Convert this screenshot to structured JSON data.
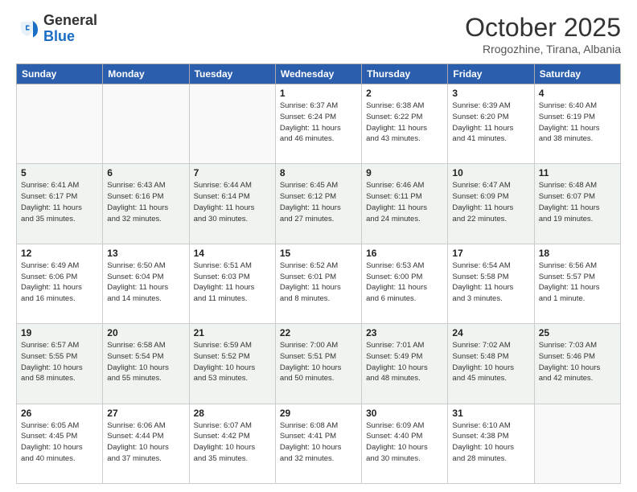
{
  "header": {
    "logo_general": "General",
    "logo_blue": "Blue",
    "month_title": "October 2025",
    "location": "Rrogozhine, Tirana, Albania"
  },
  "columns": [
    "Sunday",
    "Monday",
    "Tuesday",
    "Wednesday",
    "Thursday",
    "Friday",
    "Saturday"
  ],
  "weeks": [
    {
      "shaded": false,
      "days": [
        {
          "num": "",
          "info": ""
        },
        {
          "num": "",
          "info": ""
        },
        {
          "num": "",
          "info": ""
        },
        {
          "num": "1",
          "info": "Sunrise: 6:37 AM\nSunset: 6:24 PM\nDaylight: 11 hours\nand 46 minutes."
        },
        {
          "num": "2",
          "info": "Sunrise: 6:38 AM\nSunset: 6:22 PM\nDaylight: 11 hours\nand 43 minutes."
        },
        {
          "num": "3",
          "info": "Sunrise: 6:39 AM\nSunset: 6:20 PM\nDaylight: 11 hours\nand 41 minutes."
        },
        {
          "num": "4",
          "info": "Sunrise: 6:40 AM\nSunset: 6:19 PM\nDaylight: 11 hours\nand 38 minutes."
        }
      ]
    },
    {
      "shaded": true,
      "days": [
        {
          "num": "5",
          "info": "Sunrise: 6:41 AM\nSunset: 6:17 PM\nDaylight: 11 hours\nand 35 minutes."
        },
        {
          "num": "6",
          "info": "Sunrise: 6:43 AM\nSunset: 6:16 PM\nDaylight: 11 hours\nand 32 minutes."
        },
        {
          "num": "7",
          "info": "Sunrise: 6:44 AM\nSunset: 6:14 PM\nDaylight: 11 hours\nand 30 minutes."
        },
        {
          "num": "8",
          "info": "Sunrise: 6:45 AM\nSunset: 6:12 PM\nDaylight: 11 hours\nand 27 minutes."
        },
        {
          "num": "9",
          "info": "Sunrise: 6:46 AM\nSunset: 6:11 PM\nDaylight: 11 hours\nand 24 minutes."
        },
        {
          "num": "10",
          "info": "Sunrise: 6:47 AM\nSunset: 6:09 PM\nDaylight: 11 hours\nand 22 minutes."
        },
        {
          "num": "11",
          "info": "Sunrise: 6:48 AM\nSunset: 6:07 PM\nDaylight: 11 hours\nand 19 minutes."
        }
      ]
    },
    {
      "shaded": false,
      "days": [
        {
          "num": "12",
          "info": "Sunrise: 6:49 AM\nSunset: 6:06 PM\nDaylight: 11 hours\nand 16 minutes."
        },
        {
          "num": "13",
          "info": "Sunrise: 6:50 AM\nSunset: 6:04 PM\nDaylight: 11 hours\nand 14 minutes."
        },
        {
          "num": "14",
          "info": "Sunrise: 6:51 AM\nSunset: 6:03 PM\nDaylight: 11 hours\nand 11 minutes."
        },
        {
          "num": "15",
          "info": "Sunrise: 6:52 AM\nSunset: 6:01 PM\nDaylight: 11 hours\nand 8 minutes."
        },
        {
          "num": "16",
          "info": "Sunrise: 6:53 AM\nSunset: 6:00 PM\nDaylight: 11 hours\nand 6 minutes."
        },
        {
          "num": "17",
          "info": "Sunrise: 6:54 AM\nSunset: 5:58 PM\nDaylight: 11 hours\nand 3 minutes."
        },
        {
          "num": "18",
          "info": "Sunrise: 6:56 AM\nSunset: 5:57 PM\nDaylight: 11 hours\nand 1 minute."
        }
      ]
    },
    {
      "shaded": true,
      "days": [
        {
          "num": "19",
          "info": "Sunrise: 6:57 AM\nSunset: 5:55 PM\nDaylight: 10 hours\nand 58 minutes."
        },
        {
          "num": "20",
          "info": "Sunrise: 6:58 AM\nSunset: 5:54 PM\nDaylight: 10 hours\nand 55 minutes."
        },
        {
          "num": "21",
          "info": "Sunrise: 6:59 AM\nSunset: 5:52 PM\nDaylight: 10 hours\nand 53 minutes."
        },
        {
          "num": "22",
          "info": "Sunrise: 7:00 AM\nSunset: 5:51 PM\nDaylight: 10 hours\nand 50 minutes."
        },
        {
          "num": "23",
          "info": "Sunrise: 7:01 AM\nSunset: 5:49 PM\nDaylight: 10 hours\nand 48 minutes."
        },
        {
          "num": "24",
          "info": "Sunrise: 7:02 AM\nSunset: 5:48 PM\nDaylight: 10 hours\nand 45 minutes."
        },
        {
          "num": "25",
          "info": "Sunrise: 7:03 AM\nSunset: 5:46 PM\nDaylight: 10 hours\nand 42 minutes."
        }
      ]
    },
    {
      "shaded": false,
      "days": [
        {
          "num": "26",
          "info": "Sunrise: 6:05 AM\nSunset: 4:45 PM\nDaylight: 10 hours\nand 40 minutes."
        },
        {
          "num": "27",
          "info": "Sunrise: 6:06 AM\nSunset: 4:44 PM\nDaylight: 10 hours\nand 37 minutes."
        },
        {
          "num": "28",
          "info": "Sunrise: 6:07 AM\nSunset: 4:42 PM\nDaylight: 10 hours\nand 35 minutes."
        },
        {
          "num": "29",
          "info": "Sunrise: 6:08 AM\nSunset: 4:41 PM\nDaylight: 10 hours\nand 32 minutes."
        },
        {
          "num": "30",
          "info": "Sunrise: 6:09 AM\nSunset: 4:40 PM\nDaylight: 10 hours\nand 30 minutes."
        },
        {
          "num": "31",
          "info": "Sunrise: 6:10 AM\nSunset: 4:38 PM\nDaylight: 10 hours\nand 28 minutes."
        },
        {
          "num": "",
          "info": ""
        }
      ]
    }
  ]
}
